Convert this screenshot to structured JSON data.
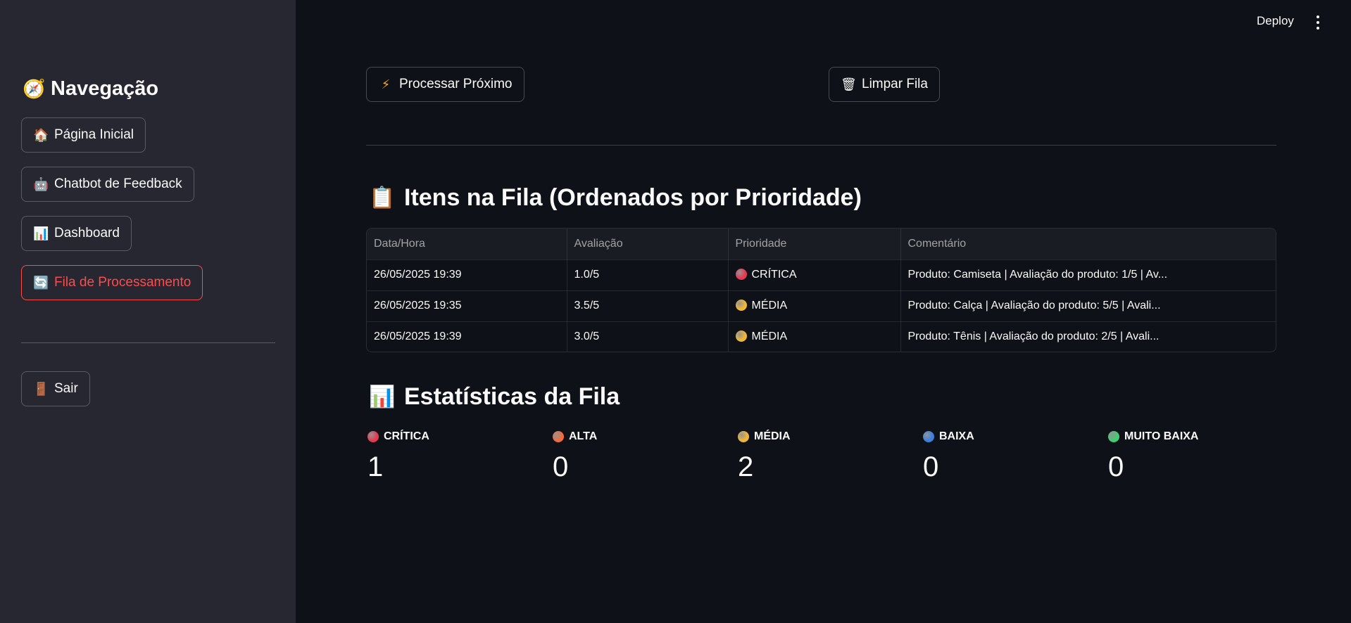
{
  "sidebar": {
    "title": "Navegação",
    "title_icon": "compass-icon",
    "items": [
      {
        "label": "Página Inicial",
        "icon": "🏠",
        "active": false
      },
      {
        "label": "Chatbot de Feedback",
        "icon": "🤖",
        "active": false
      },
      {
        "label": "Dashboard",
        "icon": "📊",
        "active": false
      },
      {
        "label": "Fila de Processamento",
        "icon": "🔄",
        "active": true
      }
    ],
    "logout": {
      "label": "Sair",
      "icon": "🚪"
    }
  },
  "topbar": {
    "deploy_label": "Deploy"
  },
  "actions": {
    "process_label": "Processar Próximo",
    "clear_label": "Limpar Fila"
  },
  "queue": {
    "title": "Itens na Fila (Ordenados por Prioridade)",
    "columns": [
      "Data/Hora",
      "Avaliação",
      "Prioridade",
      "Comentário"
    ],
    "rows": [
      {
        "datetime": "26/05/2025 19:39",
        "rating": "1.0/5",
        "priority": "CRÍTICA",
        "priority_color": "#e8384f",
        "comment": "Produto: Camiseta | Avaliação do produto: 1/5 | Av..."
      },
      {
        "datetime": "26/05/2025 19:35",
        "rating": "3.5/5",
        "priority": "MÉDIA",
        "priority_color": "#f2b632",
        "comment": "Produto: Calça | Avaliação do produto: 5/5 | Avali..."
      },
      {
        "datetime": "26/05/2025 19:39",
        "rating": "3.0/5",
        "priority": "MÉDIA",
        "priority_color": "#f2b632",
        "comment": "Produto: Tênis | Avaliação do produto: 2/5 | Avali..."
      }
    ]
  },
  "stats": {
    "title": "Estatísticas da Fila",
    "items": [
      {
        "label": "CRÍTICA",
        "value": "1",
        "color": "#e8384f"
      },
      {
        "label": "ALTA",
        "value": "0",
        "color": "#f26b3a"
      },
      {
        "label": "MÉDIA",
        "value": "2",
        "color": "#f2b632"
      },
      {
        "label": "BAIXA",
        "value": "0",
        "color": "#3b7fe0"
      },
      {
        "label": "MUITO BAIXA",
        "value": "0",
        "color": "#3fcf72"
      }
    ]
  }
}
